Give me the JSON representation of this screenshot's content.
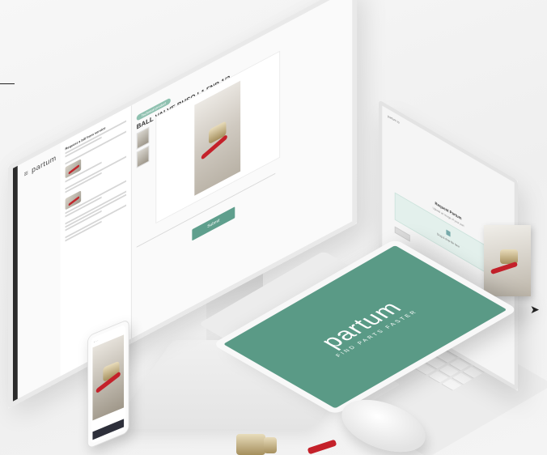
{
  "monitor": {
    "logo": "partum",
    "sidebar_heading": "Request a bill from service",
    "badge": "Technical product",
    "product_title": "BALL VALVE BHSO L1 FNB 1/2",
    "button_label": "Submit"
  },
  "laptop": {
    "tab_label": "partum.io",
    "heading": "Request Partum",
    "sub": "Upload an image of your part",
    "drop_text": "Drag & drop file here"
  },
  "tablet": {
    "brand": "partum",
    "tagline": "FIND PARTS FASTER"
  },
  "colors": {
    "accent": "#5a9a86",
    "handle_red": "#c4212a"
  }
}
